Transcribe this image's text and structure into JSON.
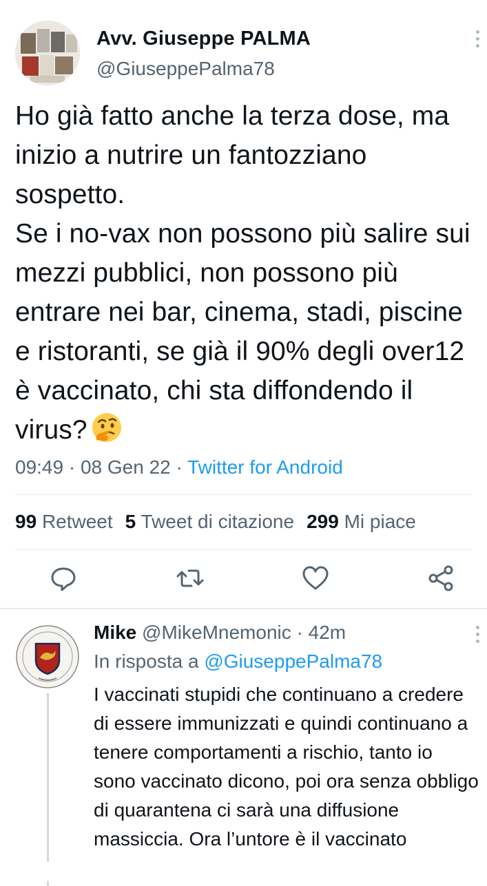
{
  "tweet": {
    "author_name": "Avv. Giuseppe PALMA",
    "author_handle": "@GiuseppePalma78",
    "text": "Ho già fatto anche la terza dose, ma inizio a nutrire un fantozziano sospetto.\nSe i no-vax non possono più salire sui mezzi pubblici, non possono più entrare nei bar, cinema, stadi, piscine e ristoranti, se già il 90% degli over12 è vaccinato, chi sta diffondendo il virus?",
    "emoji": "thinking-face-emoji",
    "time": "09:49 · 08 Gen 22 · ",
    "source": "Twitter for Android",
    "stats": {
      "retweets_count": "99",
      "retweets_label": "Retweet",
      "quotes_count": "5",
      "quotes_label": "Tweet di citazione",
      "likes_count": "299",
      "likes_label": "Mi piace"
    },
    "actions": [
      "reply-icon",
      "retweet-icon",
      "like-icon",
      "share-icon"
    ]
  },
  "reply": {
    "name": "Mike",
    "handle": "@MikeMnemonic",
    "time": "· 42m",
    "reply_prefix": "In risposta a ",
    "reply_mention": "@GiuseppePalma78",
    "text": "I vaccinati stupidi che continuano a credere di essere immunizzati e quindi continuano a tenere comportamenti a rischio, tanto io sono vaccinato dicono, poi ora senza obbligo di quarantena ci sarà una diffusione massiccia. Ora l’untore è il vaccinato"
  },
  "colors": {
    "accent": "#1d9bf0",
    "text": "#0f1419",
    "muted": "#536471",
    "divider": "#e6ecf0"
  }
}
